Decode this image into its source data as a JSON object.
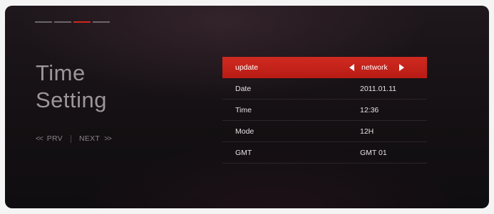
{
  "page": {
    "title_line1": "Time",
    "title_line2": "Setting"
  },
  "step_indicator": {
    "total": 4,
    "active_index": 2
  },
  "pager": {
    "prev_arrow": "<<",
    "prev_label": "PRV",
    "next_label": "NEXT",
    "next_arrow": ">>"
  },
  "settings": [
    {
      "label": "update",
      "value": "network",
      "selected": true
    },
    {
      "label": "Date",
      "value": "2011.01.11",
      "selected": false
    },
    {
      "label": "Time",
      "value": "12:36",
      "selected": false
    },
    {
      "label": "Mode",
      "value": "12H",
      "selected": false
    },
    {
      "label": "GMT",
      "value": "GMT 01",
      "selected": false
    }
  ],
  "icons": {
    "selector_left": "triangle-left-icon",
    "selector_right": "triangle-right-icon"
  },
  "colors": {
    "accent": "#d0271f",
    "background": "#141013",
    "title_text": "#9c9599"
  }
}
